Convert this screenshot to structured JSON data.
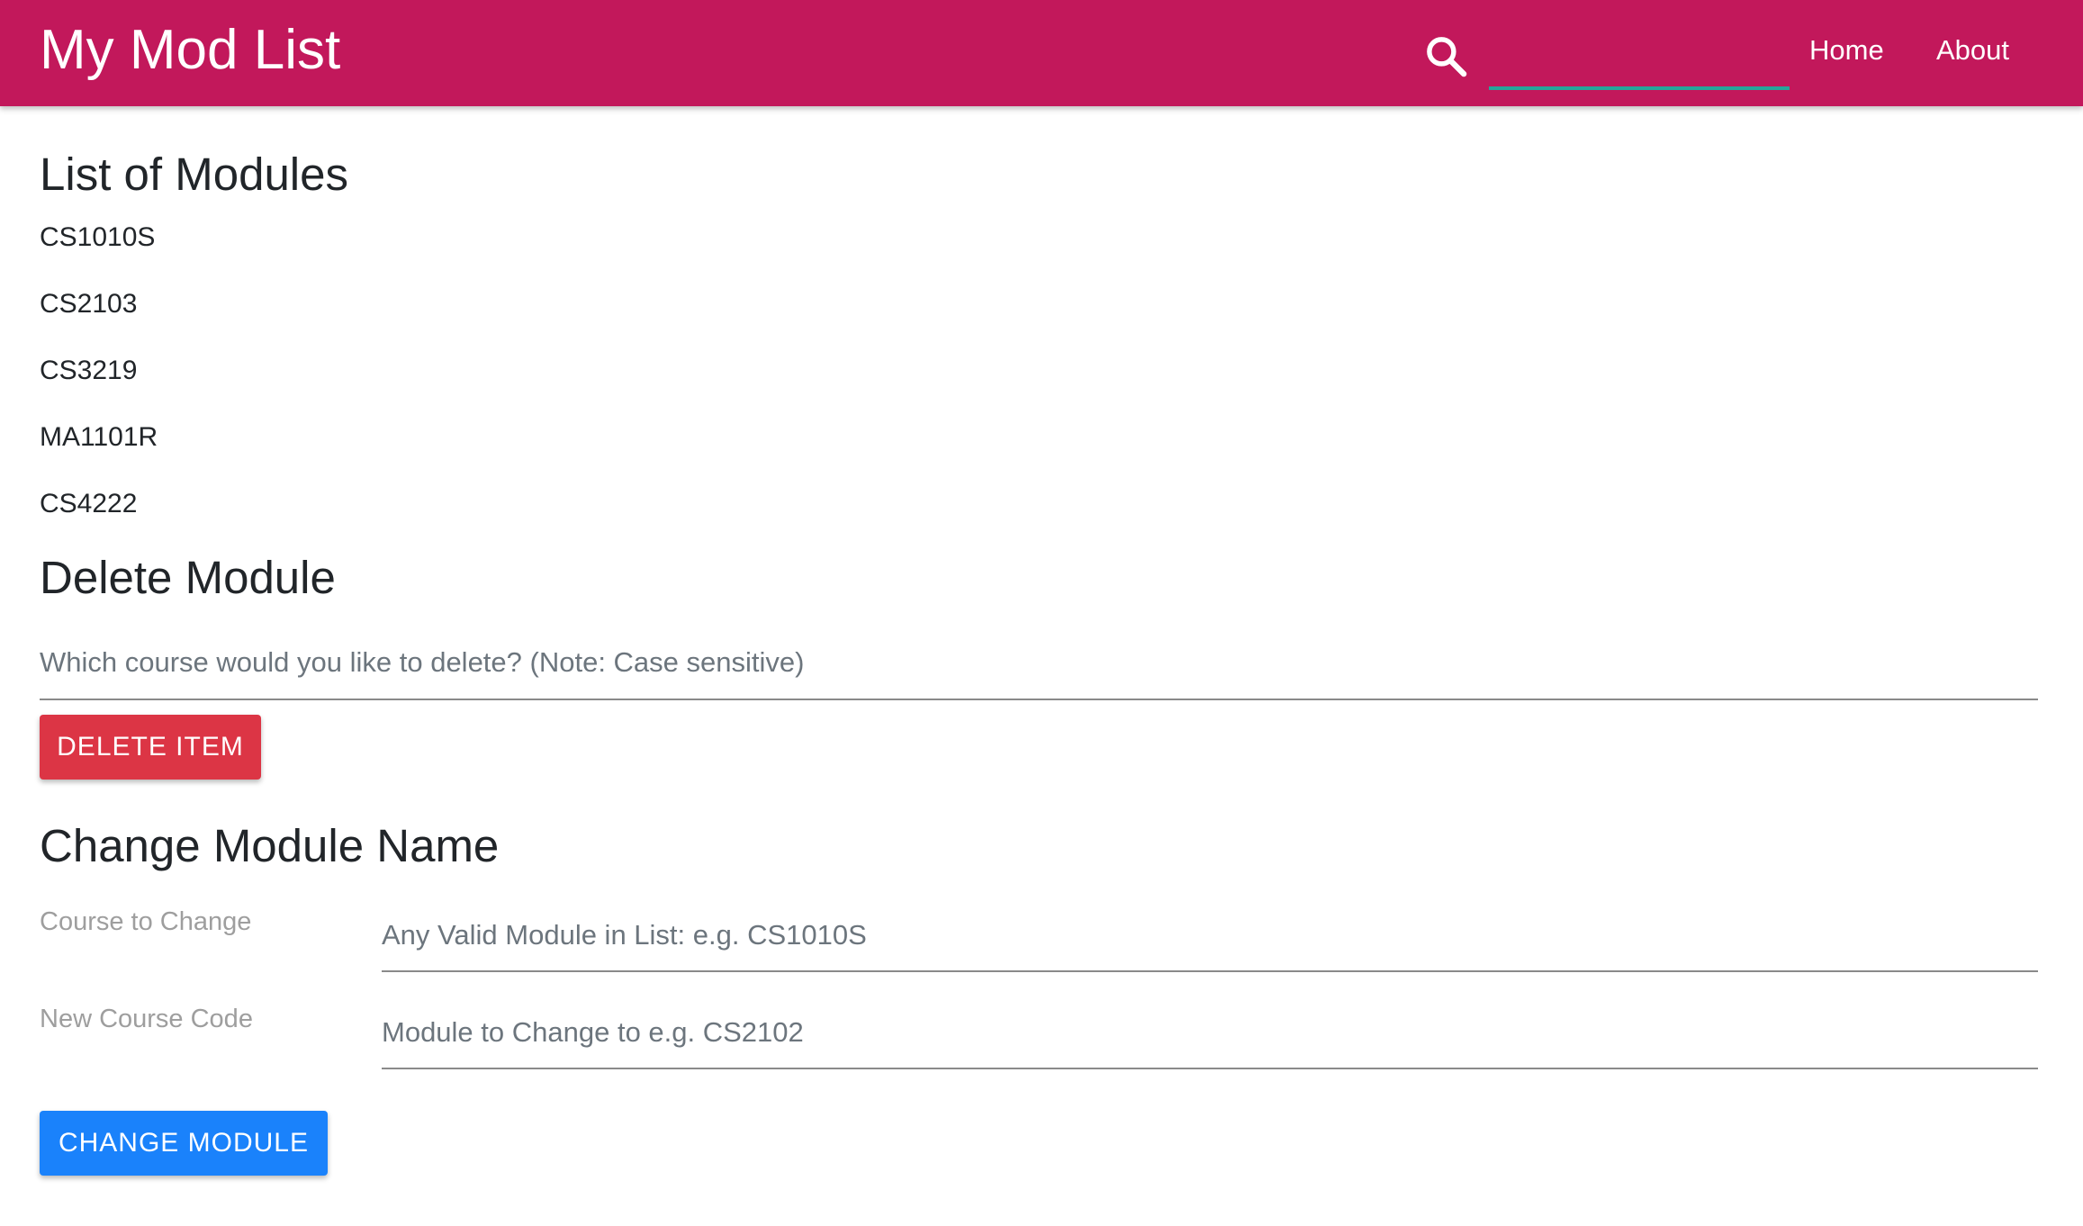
{
  "navbar": {
    "brand": "My Mod List",
    "search_icon": "search-icon",
    "search_value": "",
    "links": [
      "Home",
      "About"
    ],
    "colors": {
      "background": "#c2185b",
      "search_underline": "#26a69a"
    }
  },
  "modules": {
    "title": "List of Modules",
    "items": [
      "CS1010S",
      "CS2103",
      "CS3219",
      "MA1101R",
      "CS4222"
    ]
  },
  "delete": {
    "title": "Delete Module",
    "placeholder": "Which course would you like to delete? (Note: Case sensitive)",
    "button_label": "DELETE ITEM",
    "button_color": "#dc3545"
  },
  "change": {
    "title": "Change Module Name",
    "course_label": "Course to Change",
    "course_placeholder": "Any Valid Module in List: e.g. CS1010S",
    "new_label": "New Course Code",
    "new_placeholder": "Module to Change to e.g. CS2102",
    "button_label": "CHANGE MODULE",
    "button_color": "#1a82fb"
  }
}
